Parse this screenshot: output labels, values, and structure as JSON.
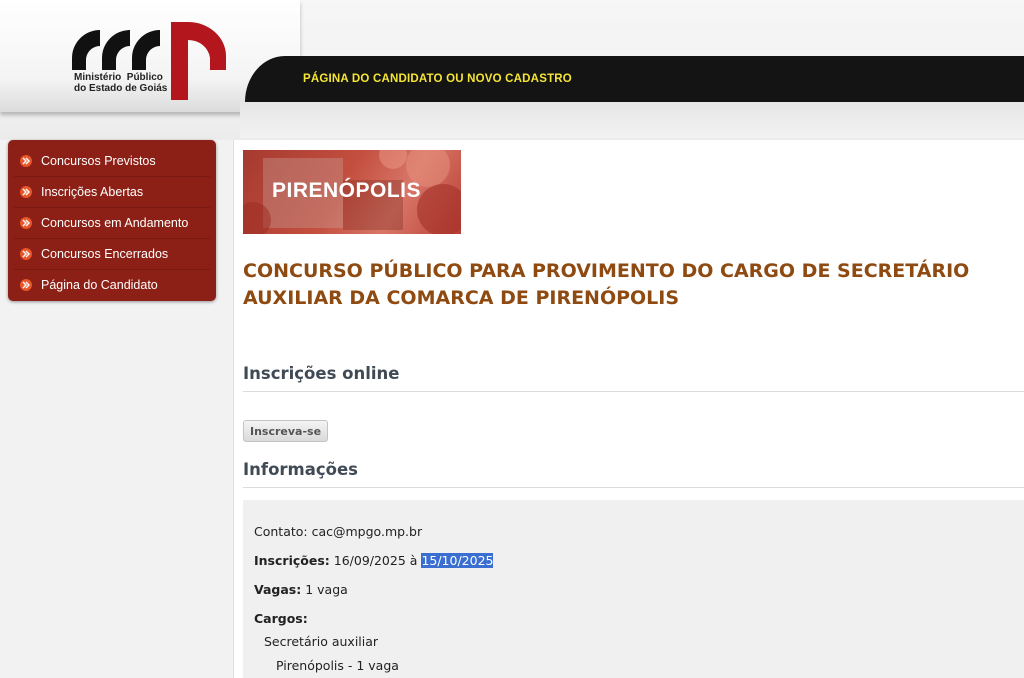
{
  "header": {
    "logo_text": "Ministério  Público\ndo Estado de Goiás",
    "nav_link": "PÁGINA DO CANDIDATO OU NOVO CADASTRO"
  },
  "sidebar": {
    "items": [
      {
        "label": "Concursos Previstos"
      },
      {
        "label": "Inscrições Abertas"
      },
      {
        "label": "Concursos em Andamento"
      },
      {
        "label": "Concursos Encerrados"
      },
      {
        "label": "Página do Candidato"
      }
    ]
  },
  "main": {
    "banner_text": "PIRENÓPOLIS",
    "title_line1": "CONCURSO PÚBLICO PARA PROVIMENTO DO CARGO DE SECRETÁRIO",
    "title_line2": "AUXILIAR DA COMARCA DE PIRENÓPOLIS",
    "online_heading": "Inscrições online",
    "subscribe_button": "Inscreva-se",
    "info_heading": "Informações",
    "info": {
      "contact": "Contato: cac@mpgo.mp.br",
      "registration_label": "Inscrições:",
      "registration_start": "16/09/2025",
      "registration_sep": "à",
      "registration_end": "15/10/2025",
      "vacancies_label": "Vagas:",
      "vacancies_value": "1 vaga",
      "positions_label": "Cargos:",
      "position_name": "Secretário auxiliar",
      "position_location": "Pirenópolis - 1 vaga"
    }
  },
  "colors": {
    "sidebar_bg": "#8c2016",
    "title_color": "#8e4a10",
    "nav_link_color": "#f5e536",
    "topbar_bg": "#141414",
    "selection_highlight": "#3a6ed0"
  }
}
